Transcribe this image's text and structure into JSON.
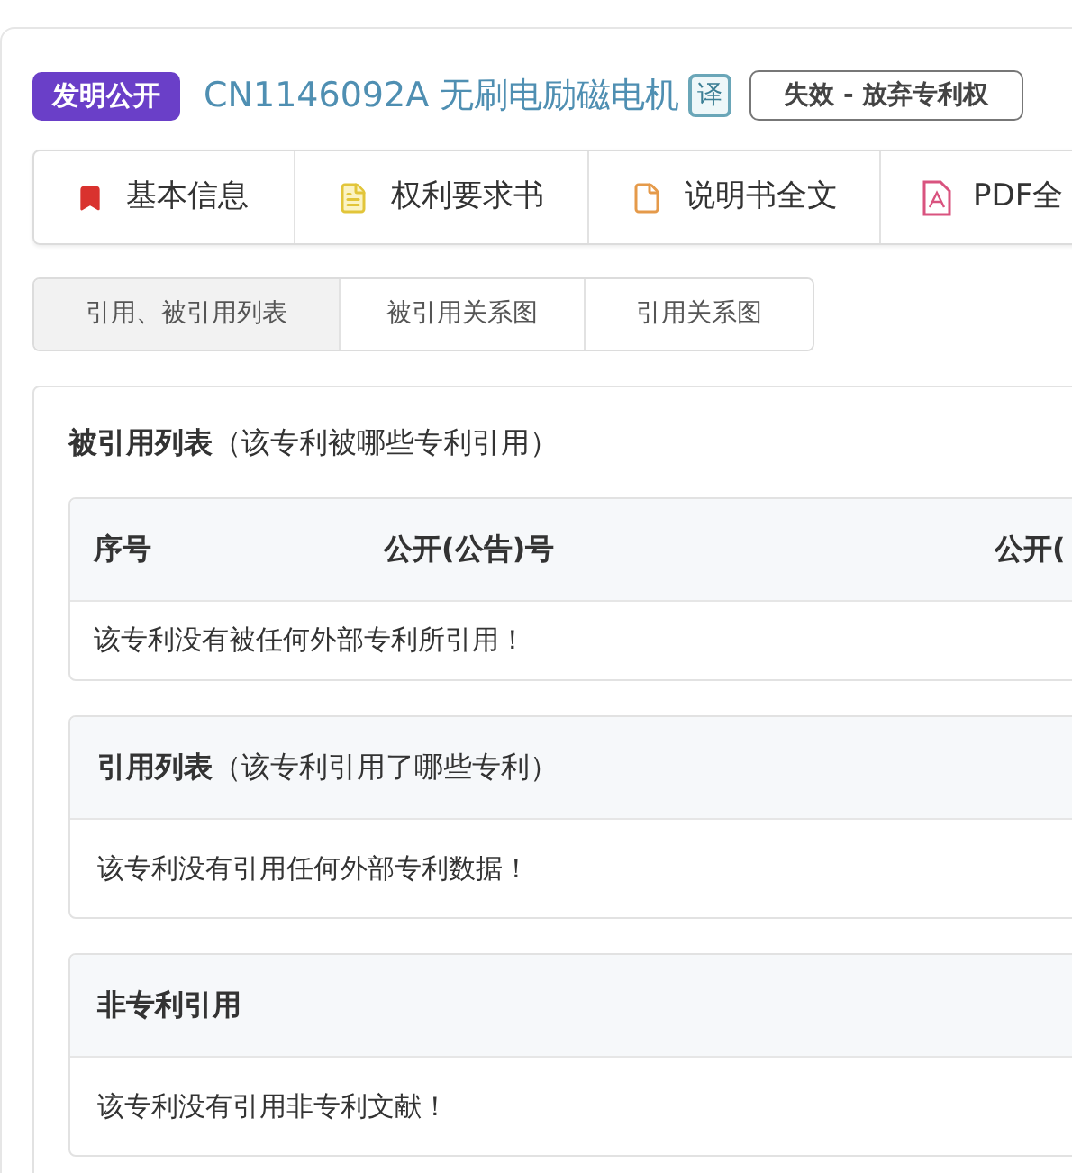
{
  "badge": "发明公开",
  "title": "CN1146092A 无刷电励磁电机",
  "translate_button": "译",
  "status": "失效 - 放弃专利权",
  "nav_tabs": [
    {
      "label": "基本信息",
      "kind": "bookmark",
      "selected": false
    },
    {
      "label": "权利要求书",
      "kind": "lines",
      "selected": false
    },
    {
      "label": "说明书全文",
      "kind": "page",
      "selected": false
    },
    {
      "label": "PDF全",
      "kind": "pdf",
      "selected": false
    }
  ],
  "sub_tabs": [
    {
      "label": "引用、被引用列表",
      "selected": true
    },
    {
      "label": "被引用关系图",
      "selected": false
    },
    {
      "label": "引用关系图",
      "selected": false
    }
  ],
  "cited_by": {
    "title": "被引用列表",
    "subtitle": "（该专利被哪些专利引用）",
    "columns": [
      "序号",
      "公开(公告)号",
      "公开("
    ],
    "empty_message": "该专利没有被任何外部专利所引用！"
  },
  "sections": [
    {
      "title": "引用列表",
      "subtitle": "（该专利引用了哪些专利）",
      "message": "该专利没有引用任何外部专利数据！"
    },
    {
      "title": "非专利引用",
      "message": "该专利没有引用非专利文献！"
    }
  ]
}
